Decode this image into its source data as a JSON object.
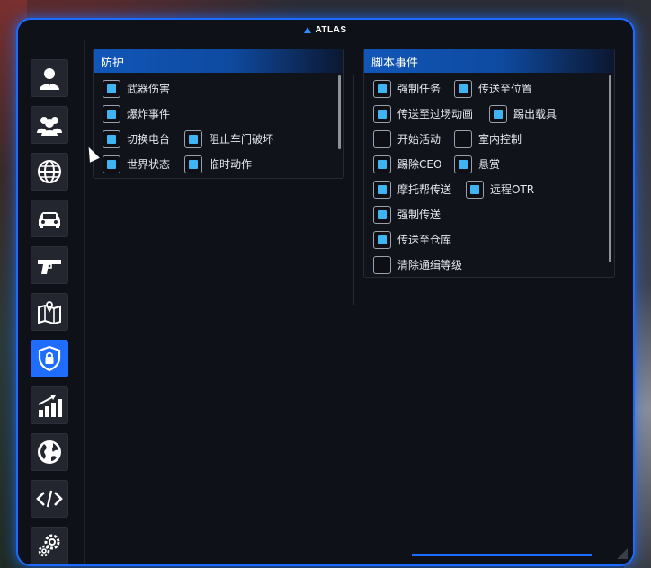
{
  "app": {
    "logo_text": "ATLAS",
    "accent_color": "#1f6dff"
  },
  "sidebar": {
    "items": [
      {
        "icon": "user-icon",
        "active": false
      },
      {
        "icon": "users-icon",
        "active": false
      },
      {
        "icon": "globe-icon",
        "active": false
      },
      {
        "icon": "car-icon",
        "active": false
      },
      {
        "icon": "pistol-icon",
        "active": false
      },
      {
        "icon": "map-icon",
        "active": false
      },
      {
        "icon": "shield-lock-icon",
        "active": true
      },
      {
        "icon": "chart-icon",
        "active": false
      },
      {
        "icon": "earth-icon",
        "active": false
      },
      {
        "icon": "code-icon",
        "active": false
      },
      {
        "icon": "gears-icon",
        "active": false
      }
    ]
  },
  "protection": {
    "title": "防护",
    "items": [
      {
        "label": "武器伤害",
        "checked": true
      },
      {
        "label": "爆炸事件",
        "checked": true
      },
      {
        "label": "切换电台",
        "checked": true
      },
      {
        "label": "阻止车门破坏",
        "checked": true
      },
      {
        "label": "世界状态",
        "checked": true
      },
      {
        "label": "临时动作",
        "checked": true
      }
    ]
  },
  "script_events": {
    "title": "脚本事件",
    "items": [
      {
        "label": "强制任务",
        "checked": true
      },
      {
        "label": "传送至位置",
        "checked": true
      },
      {
        "label": "传送至过场动画",
        "checked": true
      },
      {
        "label": "踢出载具",
        "checked": true
      },
      {
        "label": "开始活动",
        "checked": false
      },
      {
        "label": "室内控制",
        "checked": false
      },
      {
        "label": "踢除CEO",
        "checked": true
      },
      {
        "label": "悬赏",
        "checked": true
      },
      {
        "label": "摩托帮传送",
        "checked": true
      },
      {
        "label": "远程OTR",
        "checked": true
      },
      {
        "label": "强制传送",
        "checked": true
      },
      {
        "label": "传送至仓库",
        "checked": true
      },
      {
        "label": "清除通缉等级",
        "checked": false
      }
    ]
  }
}
